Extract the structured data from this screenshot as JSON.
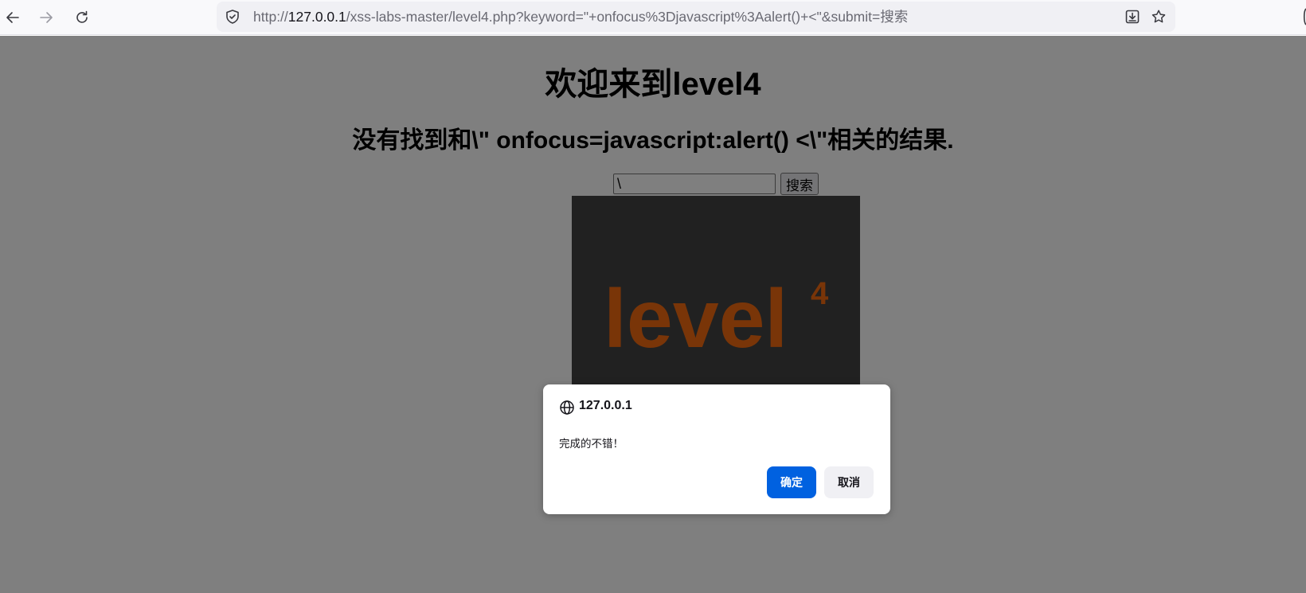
{
  "browser": {
    "url": {
      "scheme": "http://",
      "host": "127.0.0.1",
      "path": "/xss-labs-master/level4.php?keyword=\"+onfocus%3Djavascript%3Aalert()+<\"&submit=搜索"
    },
    "icons": {
      "back": "back-arrow-icon",
      "forward": "forward-arrow-icon",
      "reload": "reload-icon",
      "site_security": "shield-icon",
      "download": "download-icon",
      "bookmark": "star-icon"
    }
  },
  "page": {
    "title": "欢迎来到level4",
    "result": "没有找到和\\\" onfocus=javascript:alert() <\\\"相关的结果.",
    "keyword_value": "\\",
    "search_button_label": "搜索",
    "level_image_text": "level",
    "level_image_superscript": "4",
    "colors": {
      "level_image_bg": "#434343",
      "level_image_text": "#f26b10"
    }
  },
  "dialog": {
    "origin": "127.0.0.1",
    "origin_icon": "globe-icon",
    "message": "完成的不错！",
    "ok_label": "确定",
    "cancel_label": "取消",
    "colors": {
      "ok_bg": "#0061e0",
      "cancel_bg": "#f0f0f4"
    }
  }
}
